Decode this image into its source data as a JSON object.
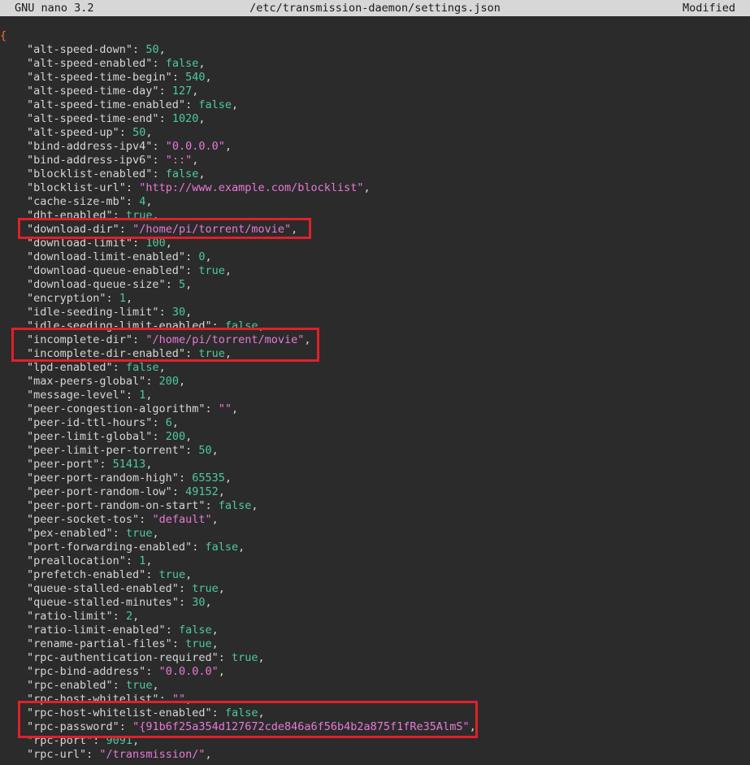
{
  "titlebar": {
    "app": "GNU nano 3.2",
    "file": "/etc/transmission-daemon/settings.json",
    "status": "Modified"
  },
  "open_brace": "{",
  "lines": [
    {
      "key": "\"alt-speed-down\"",
      "value": "50",
      "type": "num"
    },
    {
      "key": "\"alt-speed-enabled\"",
      "value": "false",
      "type": "bool"
    },
    {
      "key": "\"alt-speed-time-begin\"",
      "value": "540",
      "type": "num"
    },
    {
      "key": "\"alt-speed-time-day\"",
      "value": "127",
      "type": "num"
    },
    {
      "key": "\"alt-speed-time-enabled\"",
      "value": "false",
      "type": "bool"
    },
    {
      "key": "\"alt-speed-time-end\"",
      "value": "1020",
      "type": "num"
    },
    {
      "key": "\"alt-speed-up\"",
      "value": "50",
      "type": "num"
    },
    {
      "key": "\"bind-address-ipv4\"",
      "value": "\"0.0.0.0\"",
      "type": "str"
    },
    {
      "key": "\"bind-address-ipv6\"",
      "value": "\"::\"",
      "type": "str"
    },
    {
      "key": "\"blocklist-enabled\"",
      "value": "false",
      "type": "bool"
    },
    {
      "key": "\"blocklist-url\"",
      "value": "\"http://www.example.com/blocklist\"",
      "type": "str"
    },
    {
      "key": "\"cache-size-mb\"",
      "value": "4",
      "type": "num"
    },
    {
      "key": "\"dht-enabled\"",
      "value": "true",
      "type": "bool"
    },
    {
      "key": "\"download-dir\"",
      "value": "\"/home/pi/torrent/movie\"",
      "type": "str"
    },
    {
      "key": "\"download-limit\"",
      "value": "100",
      "type": "num"
    },
    {
      "key": "\"download-limit-enabled\"",
      "value": "0",
      "type": "num"
    },
    {
      "key": "\"download-queue-enabled\"",
      "value": "true",
      "type": "bool"
    },
    {
      "key": "\"download-queue-size\"",
      "value": "5",
      "type": "num"
    },
    {
      "key": "\"encryption\"",
      "value": "1",
      "type": "num"
    },
    {
      "key": "\"idle-seeding-limit\"",
      "value": "30",
      "type": "num"
    },
    {
      "key": "\"idle-seeding-limit-enabled\"",
      "value": "false",
      "type": "bool"
    },
    {
      "key": "\"incomplete-dir\"",
      "value": "\"/home/pi/torrent/movie\"",
      "type": "str"
    },
    {
      "key": "\"incomplete-dir-enabled\"",
      "value": "true",
      "type": "bool"
    },
    {
      "key": "\"lpd-enabled\"",
      "value": "false",
      "type": "bool"
    },
    {
      "key": "\"max-peers-global\"",
      "value": "200",
      "type": "num"
    },
    {
      "key": "\"message-level\"",
      "value": "1",
      "type": "num"
    },
    {
      "key": "\"peer-congestion-algorithm\"",
      "value": "\"\"",
      "type": "str"
    },
    {
      "key": "\"peer-id-ttl-hours\"",
      "value": "6",
      "type": "num"
    },
    {
      "key": "\"peer-limit-global\"",
      "value": "200",
      "type": "num"
    },
    {
      "key": "\"peer-limit-per-torrent\"",
      "value": "50",
      "type": "num"
    },
    {
      "key": "\"peer-port\"",
      "value": "51413",
      "type": "num"
    },
    {
      "key": "\"peer-port-random-high\"",
      "value": "65535",
      "type": "num"
    },
    {
      "key": "\"peer-port-random-low\"",
      "value": "49152",
      "type": "num"
    },
    {
      "key": "\"peer-port-random-on-start\"",
      "value": "false",
      "type": "bool"
    },
    {
      "key": "\"peer-socket-tos\"",
      "value": "\"default\"",
      "type": "str"
    },
    {
      "key": "\"pex-enabled\"",
      "value": "true",
      "type": "bool"
    },
    {
      "key": "\"port-forwarding-enabled\"",
      "value": "false",
      "type": "bool"
    },
    {
      "key": "\"preallocation\"",
      "value": "1",
      "type": "num"
    },
    {
      "key": "\"prefetch-enabled\"",
      "value": "true",
      "type": "bool"
    },
    {
      "key": "\"queue-stalled-enabled\"",
      "value": "true",
      "type": "bool"
    },
    {
      "key": "\"queue-stalled-minutes\"",
      "value": "30",
      "type": "num"
    },
    {
      "key": "\"ratio-limit\"",
      "value": "2",
      "type": "num"
    },
    {
      "key": "\"ratio-limit-enabled\"",
      "value": "false",
      "type": "bool"
    },
    {
      "key": "\"rename-partial-files\"",
      "value": "true",
      "type": "bool"
    },
    {
      "key": "\"rpc-authentication-required\"",
      "value": "true",
      "type": "bool"
    },
    {
      "key": "\"rpc-bind-address\"",
      "value": "\"0.0.0.0\"",
      "type": "str"
    },
    {
      "key": "\"rpc-enabled\"",
      "value": "true",
      "type": "bool"
    },
    {
      "key": "\"rpc-host-whitelist\"",
      "value": "\"\"",
      "type": "str"
    },
    {
      "key": "\"rpc-host-whitelist-enabled\"",
      "value": "false",
      "type": "bool"
    },
    {
      "key": "\"rpc-password\"",
      "value": "\"{91b6f25a354d127672cde846a6f56b4b2a875f1fRe35AlmS\"",
      "type": "str"
    },
    {
      "key": "\"rpc-port\"",
      "value": "9091",
      "type": "num"
    },
    {
      "key": "\"rpc-url\"",
      "value": "\"/transmission/\"",
      "type": "str"
    }
  ],
  "colors": {
    "background": "#2b2b2b",
    "titlebar": "#d7d7d7",
    "key": "#d6d6d6",
    "string": "#e879d8",
    "number": "#4ec9a0",
    "brace": "#ff6d2e",
    "highlight": "#e0202a"
  }
}
